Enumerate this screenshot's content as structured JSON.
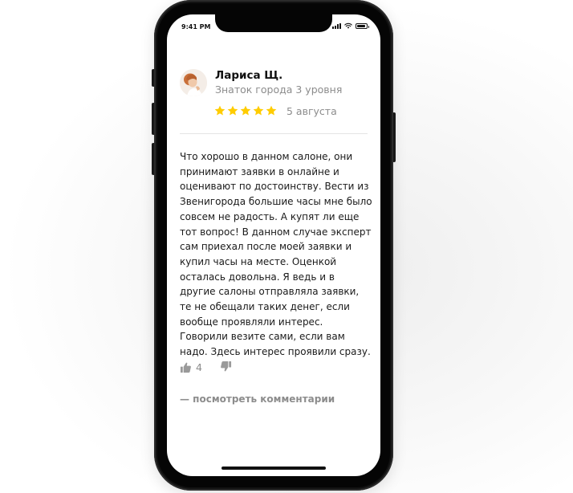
{
  "status_bar": {
    "time": "9:41 PM",
    "icons": [
      "signal-icon",
      "wifi-icon",
      "battery-icon"
    ]
  },
  "review": {
    "author": {
      "name": "Лариса Щ.",
      "level": "Знаток города 3 уровня"
    },
    "rating": 5,
    "rating_max": 5,
    "date": "5 августа",
    "text": "Что хорошо в данном салоне, они принимают заявки в онлайне и оценивают по достоинству. Вести из Звенигорода большие часы мне было совсем не радость. А купят ли еще тот вопрос! В данном случае эксперт сам приехал после моей заявки и купил часы на месте. Оценкой осталась довольна. Я ведь и в другие салоны отправляла заявки, те не обещали таких денег, если вообще проявляли интерес. Говорили везите сами, если вам надо. Здесь интерес проявили сразу.",
    "likes": "4",
    "comments_link": "— посмотреть комментарии"
  },
  "colors": {
    "star": "#FFCC00",
    "muted_text": "#8C8C8C",
    "body_text": "#1A1A1A",
    "phone_frame": "#121212"
  }
}
